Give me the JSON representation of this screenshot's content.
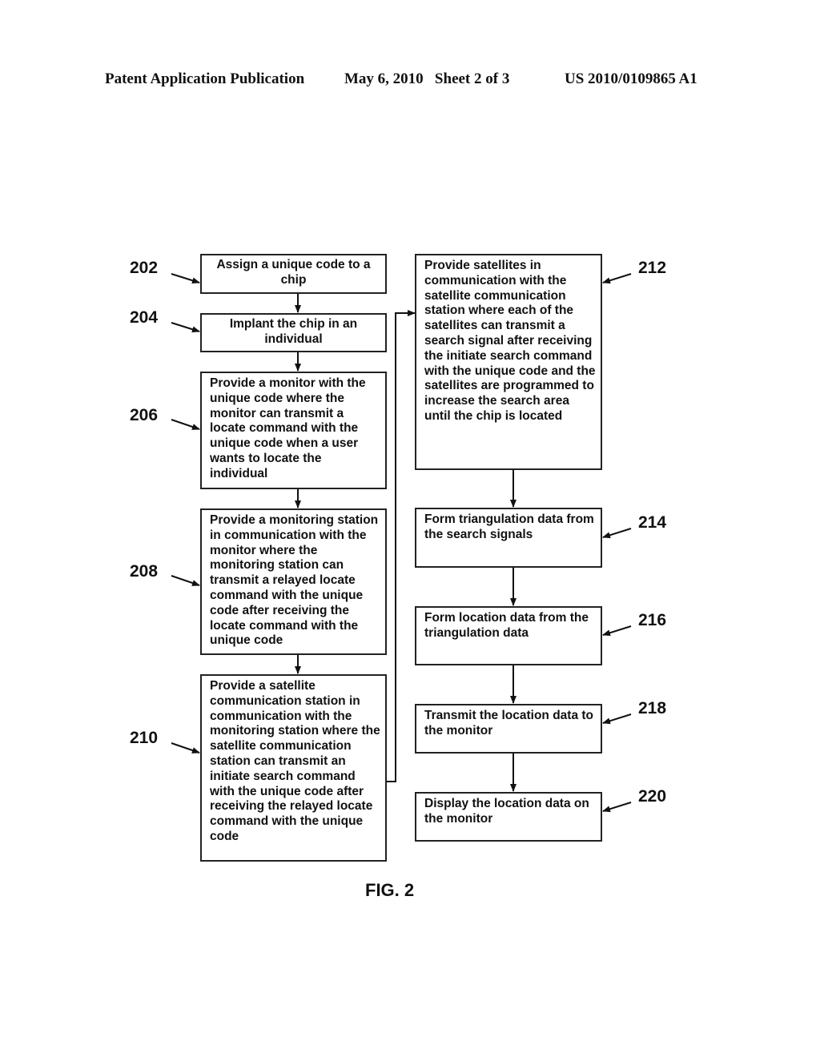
{
  "header": {
    "publication": "Patent Application Publication",
    "date_sheet": "May 6, 2010   Sheet 2 of 3",
    "number": "US 2010/0109865 A1"
  },
  "figure_label": "FIG. 2",
  "steps": [
    {
      "ref": "202",
      "text": "Assign a unique code to a chip"
    },
    {
      "ref": "204",
      "text": "Implant the chip in an individual"
    },
    {
      "ref": "206",
      "text": "Provide a monitor with the unique code where the monitor can transmit a locate command with the unique code when a user wants to locate the individual"
    },
    {
      "ref": "208",
      "text": "Provide a monitoring station in communication with the monitor where the monitoring station can transmit a relayed locate command with the unique code after receiving the locate command with the unique code"
    },
    {
      "ref": "210",
      "text": "Provide a satellite communication station in communication with the monitoring station where the satellite communication station can transmit an initiate search command with the unique code after receiving the relayed locate command with the unique code"
    },
    {
      "ref": "212",
      "text": "Provide satellites in communication with the satellite communication station where each of the satellites can transmit a search signal after receiving the initiate search command with the unique code and the satellites are programmed to increase the search area until the chip is located"
    },
    {
      "ref": "214",
      "text": "Form triangulation data from the search signals"
    },
    {
      "ref": "216",
      "text": "Form location data from the triangulation data"
    },
    {
      "ref": "218",
      "text": "Transmit the location data to the monitor"
    },
    {
      "ref": "220",
      "text": "Display the location data on the monitor"
    }
  ],
  "flow": [
    [
      "202",
      "204"
    ],
    [
      "204",
      "206"
    ],
    [
      "206",
      "208"
    ],
    [
      "208",
      "210"
    ],
    [
      "210",
      "212"
    ],
    [
      "212",
      "214"
    ],
    [
      "214",
      "216"
    ],
    [
      "216",
      "218"
    ],
    [
      "218",
      "220"
    ]
  ]
}
